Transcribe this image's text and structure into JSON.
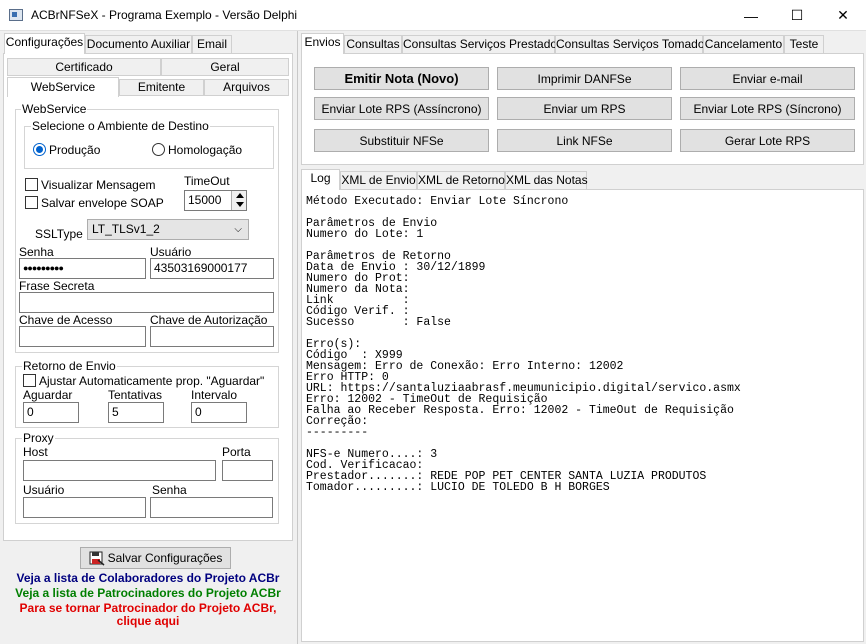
{
  "window": {
    "title": "ACBrNFSeX - Programa Exemplo - Versão Delphi",
    "minimize": "—",
    "maximize": "☐",
    "close": "✕"
  },
  "left_tabs": [
    "Configurações",
    "Documento Auxiliar",
    "Email"
  ],
  "config_tabs_row1": [
    "Certificado",
    "Geral"
  ],
  "config_tabs_row2": [
    "WebService",
    "Emitente",
    "Arquivos"
  ],
  "webservice": {
    "group_title": "WebService",
    "ambiente_title": "Selecione o Ambiente de Destino",
    "producao": "Produção",
    "homologacao": "Homologação",
    "visualizar": "Visualizar Mensagem",
    "salvar_envelope": "Salvar envelope SOAP",
    "timeout_label": "TimeOut",
    "timeout_value": "15000",
    "ssltype_label": "SSLType",
    "ssltype_value": "LT_TLSv1_2",
    "senha_label": "Senha",
    "senha_value": "●●●●●●●●●",
    "usuario_label": "Usuário",
    "usuario_value": "43503169000177",
    "frase_label": "Frase Secreta",
    "frase_value": "",
    "chave_acesso_label": "Chave de Acesso",
    "chave_autorizacao_label": "Chave de Autorização"
  },
  "retorno": {
    "title": "Retorno de Envio",
    "ajustar": "Ajustar Automaticamente prop. \"Aguardar\"",
    "aguardar_label": "Aguardar",
    "aguardar_value": "0",
    "tentativas_label": "Tentativas",
    "tentativas_value": "5",
    "intervalo_label": "Intervalo",
    "intervalo_value": "0"
  },
  "proxy": {
    "title": "Proxy",
    "host": "Host",
    "porta": "Porta",
    "usuario": "Usuário",
    "senha": "Senha"
  },
  "salvar_button": "Salvar Configurações",
  "links": {
    "colaboradores": "Veja a lista de Colaboradores do Projeto ACBr",
    "patrocinadores": "Veja a lista de Patrocinadores do Projeto ACBr",
    "tornar1": "Para se tornar Patrocinador do Projeto ACBr,",
    "tornar2": "clique aqui"
  },
  "right_tabs": [
    "Envios",
    "Consultas",
    "Consultas Serviços Prestados",
    "Consultas Serviços Tomados",
    "Cancelamento",
    "Teste"
  ],
  "buttons": [
    "Emitir Nota (Novo)",
    "Imprimir DANFSe",
    "Enviar e-mail",
    "Enviar Lote RPS (Assíncrono)",
    "Enviar um RPS",
    "Enviar Lote RPS (Síncrono)",
    "Substituir NFSe",
    "Link NFSe",
    "Gerar Lote RPS"
  ],
  "log_tabs": [
    "Log",
    "XML de Envio",
    "XML de Retorno",
    "XML das Notas"
  ],
  "log_lines": [
    "Método Executado: Enviar Lote Síncrono",
    "",
    "Parâmetros de Envio",
    "Numero do Lote: 1",
    "",
    "Parâmetros de Retorno",
    "Data de Envio : 30/12/1899",
    "Numero do Prot:",
    "Numero da Nota:",
    "Link          :",
    "Código Verif. :",
    "Sucesso       : False",
    "",
    "Erro(s):",
    "Código  : X999",
    "Mensagem: Erro de Conexão: Erro Interno: 12002",
    "Erro HTTP: 0",
    "URL: https://santaluziaabrasf.meumunicipio.digital/servico.asmx",
    "Erro: 12002 - TimeOut de Requisição",
    "Falha ao Receber Resposta. Erro: 12002 - TimeOut de Requisição",
    "Correção:",
    "---------",
    "",
    "NFS-e Numero....: 3",
    "Cod. Verificacao:",
    "Prestador.......: REDE POP PET CENTER SANTA LUZIA PRODUTOS",
    "Tomador.........: LUCIO DE TOLEDO B H BORGES"
  ],
  "colors": {
    "link_blue": "#00007f",
    "link_green": "#007f00",
    "link_red": "#e00000",
    "radio_accent": "#0062ce"
  }
}
